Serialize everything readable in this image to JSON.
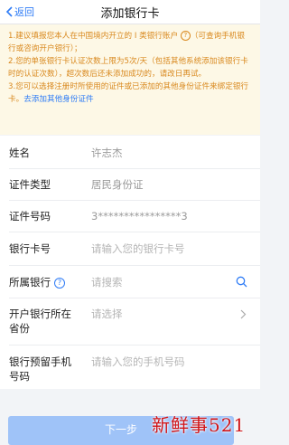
{
  "nav": {
    "back_label": "返回",
    "title": "添加银行卡"
  },
  "notice": {
    "line1_part1": "1.建议填报您本人在中国境内开立的 I 类银行账户 ",
    "line1_part2": "（可查询手机银行或咨询开户银行）；",
    "line2": "2.您的单张银行卡认证次数上限为5次/天（包括其他系统添加该银行卡时的认证次数），超次数后还未添加成功的，请改日再试。",
    "line3_text": "3.您可以选择注册时所使用的证件或已添加的其他身份证件来绑定银行卡。",
    "line3_link": "去添加其他身份证件"
  },
  "form": {
    "name": {
      "label": "姓名",
      "value": "许志杰"
    },
    "id_type": {
      "label": "证件类型",
      "value": "居民身份证"
    },
    "id_number": {
      "label": "证件号码",
      "value": "3****************3"
    },
    "card_number": {
      "label": "银行卡号",
      "placeholder": "请输入您的银行卡号"
    },
    "bank": {
      "label": "所属银行",
      "placeholder": "请搜索"
    },
    "province": {
      "label_line1": "开户银行所在",
      "label_line2": "省份",
      "placeholder": "请选择"
    },
    "phone": {
      "label_line1": "银行预留手机",
      "label_line2": "号码",
      "placeholder": "请输入您的手机号码"
    }
  },
  "next_button": "下一步",
  "watermark": "新鲜事521",
  "colors": {
    "accent": "#2f7cf6",
    "notice_text": "#d9891f",
    "notice_bg": "#fdf8e6"
  },
  "icons": [
    "chevron-left-icon",
    "help-circle-icon",
    "search-icon",
    "chevron-right-icon"
  ]
}
